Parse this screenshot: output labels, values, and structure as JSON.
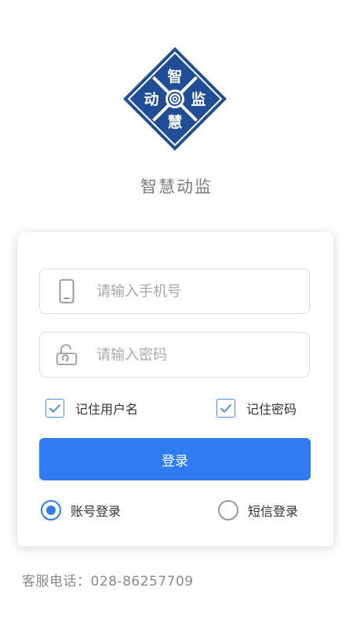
{
  "logo": {
    "characters": [
      "智",
      "动",
      "监",
      "慧"
    ],
    "colors": {
      "primary": "#1f4e96",
      "background": "#ffffff"
    }
  },
  "app_name": "智慧动监",
  "login_form": {
    "phone_placeholder": "请输入手机号",
    "phone_icon": "phone-icon",
    "password_placeholder": "请输入密码",
    "password_icon": "unlock-icon",
    "remember_username": {
      "label": "记住用户名",
      "checked": true
    },
    "remember_password": {
      "label": "记住密码",
      "checked": true
    },
    "login_button": "登录",
    "login_modes": [
      {
        "label": "账号登录",
        "selected": true
      },
      {
        "label": "短信登录",
        "selected": false
      }
    ]
  },
  "service_hotline": "客服电话：028-86257709",
  "colors": {
    "accent": "#2f7cf0",
    "checkbox_border": "#4a8fe0",
    "muted_text": "#8a8a8a"
  }
}
